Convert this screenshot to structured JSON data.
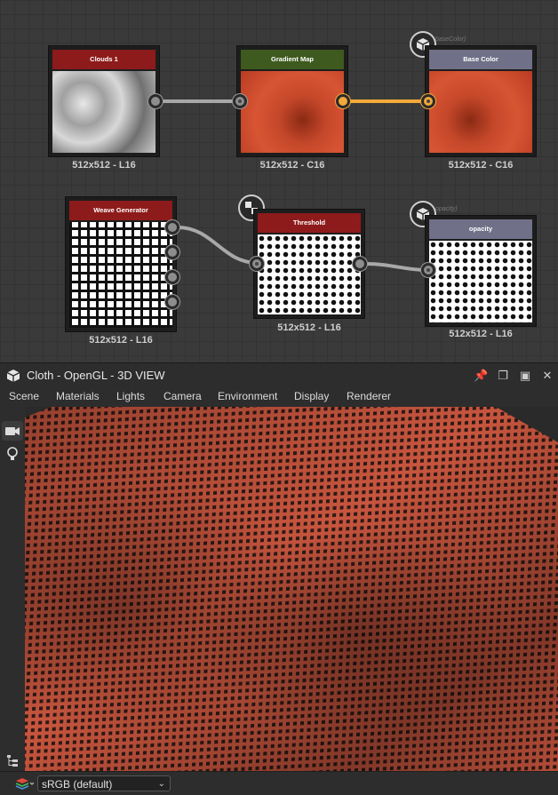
{
  "graph": {
    "nodes": [
      {
        "id": "clouds",
        "title": "Clouds 1",
        "res": "512x512 - L16",
        "header_color": "#8e1b1b"
      },
      {
        "id": "gradient",
        "title": "Gradient Map",
        "res": "512x512 - C16",
        "header_color": "#3e5a1e"
      },
      {
        "id": "basecolor",
        "title": "Base Color",
        "res": "512x512 - C16",
        "header_color": "#707088",
        "output_label": "baseColor)"
      },
      {
        "id": "weave",
        "title": "Weave Generator",
        "res": "512x512 - L16",
        "header_color": "#8e1b1b"
      },
      {
        "id": "threshold",
        "title": "Threshold",
        "res": "512x512 - L16",
        "header_color": "#8e1b1b"
      },
      {
        "id": "opacity",
        "title": "opacity",
        "res": "512x512 - L16",
        "header_color": "#707088",
        "output_label": "opacity)"
      }
    ],
    "badges": [
      "cube-icon",
      "checker-icon",
      "cube-icon"
    ]
  },
  "view3d": {
    "title": "Cloth - OpenGL - 3D VIEW",
    "menu": [
      "Scene",
      "Materials",
      "Lights",
      "Camera",
      "Environment",
      "Display",
      "Renderer"
    ],
    "window_buttons": [
      "pin-icon",
      "float-icon",
      "maximize-icon",
      "close-icon"
    ],
    "sidebar_tools": [
      "camera-icon",
      "light-bulb-icon"
    ],
    "colorspace": "sRGB (default)",
    "fabric_color": "#c8553e"
  }
}
